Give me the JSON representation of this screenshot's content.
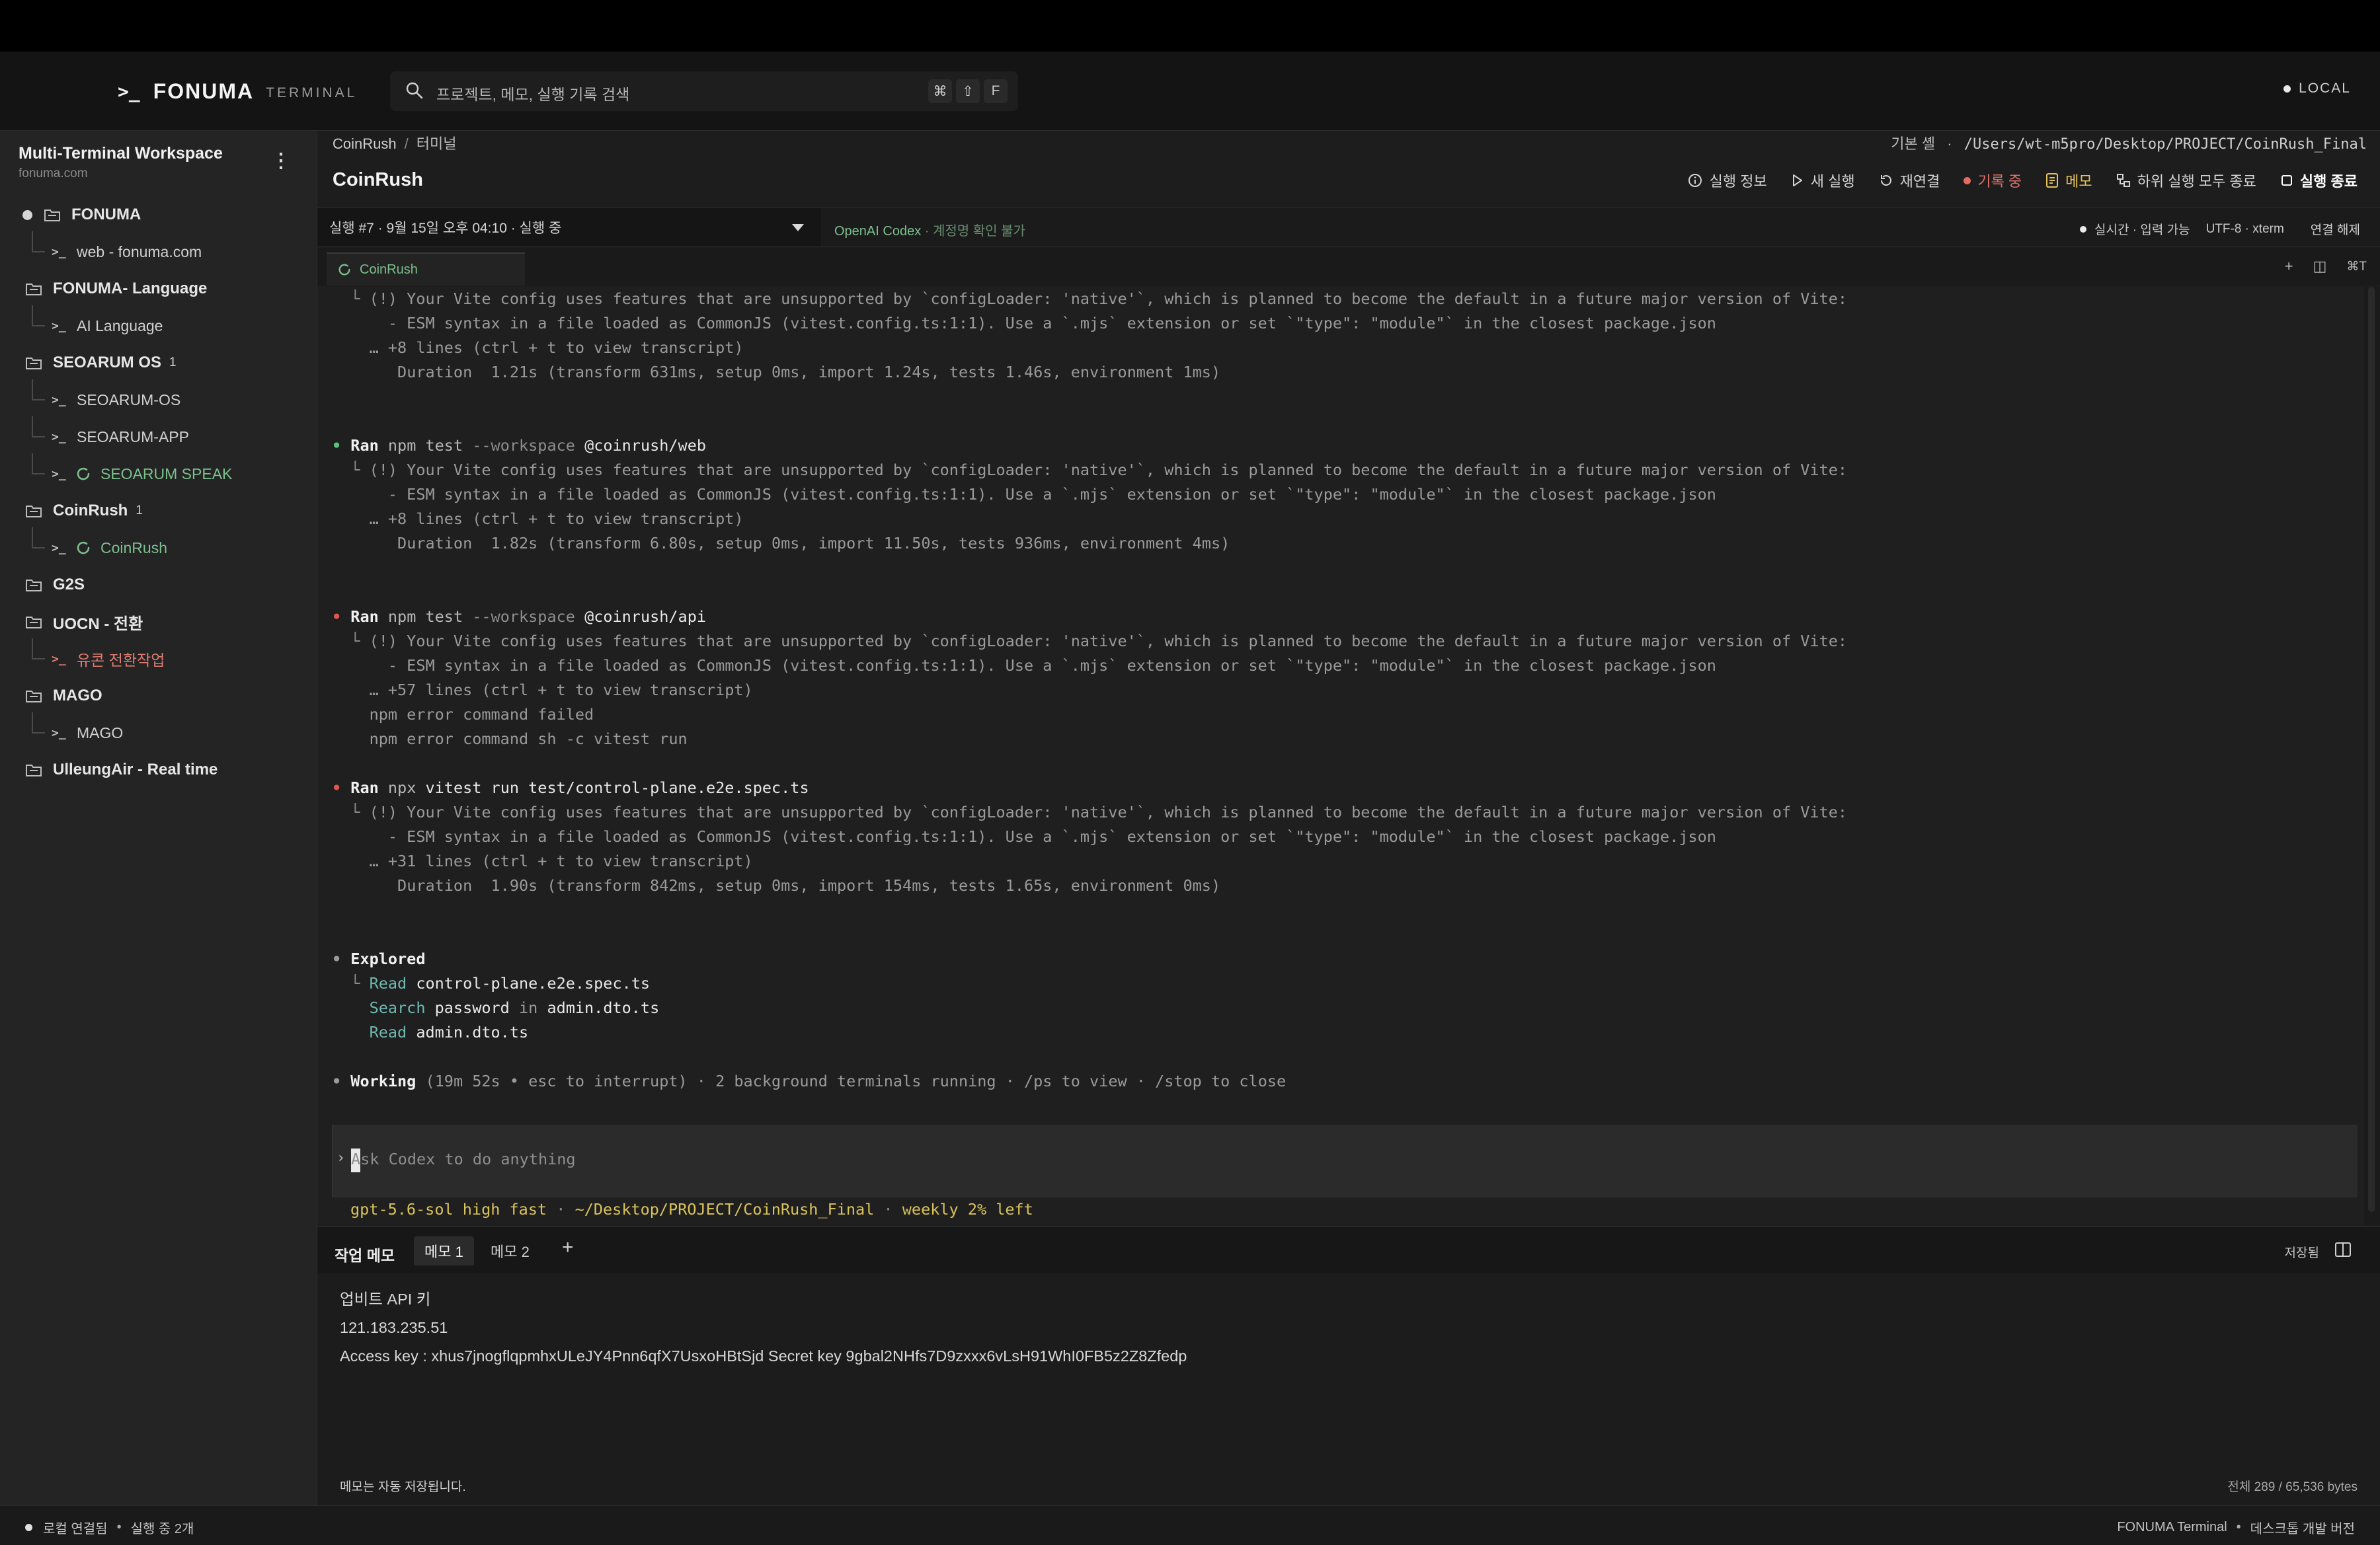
{
  "header": {
    "prompt_glyph": ">_",
    "brand": "FONUMA",
    "brand_sub": "TERMINAL",
    "search_placeholder": "프로젝트, 메모, 실행 기록 검색",
    "shortcut_keys": [
      "⌘",
      "⇧",
      "F"
    ],
    "mode": "LOCAL"
  },
  "sidebar": {
    "workspace_title": "Multi-Terminal Workspace",
    "workspace_sub": "fonuma.com",
    "more": "⋮",
    "groups": [
      {
        "label": "FONUMA",
        "badge": "",
        "active_dot": true,
        "children": [
          {
            "label": "web - fonuma.com",
            "state": "idle"
          }
        ]
      },
      {
        "label": "FONUMA- Language",
        "badge": "",
        "children": [
          {
            "label": "AI Language",
            "state": "idle"
          }
        ]
      },
      {
        "label": "SEOARUM OS",
        "badge": "1",
        "children": [
          {
            "label": "SEOARUM-OS",
            "state": "idle"
          },
          {
            "label": "SEOARUM-APP",
            "state": "idle"
          },
          {
            "label": "SEOARUM SPEAK",
            "state": "running"
          }
        ]
      },
      {
        "label": "CoinRush",
        "badge": "1",
        "children": [
          {
            "label": "CoinRush",
            "state": "running"
          }
        ]
      },
      {
        "label": "G2S",
        "badge": "",
        "children": []
      },
      {
        "label": "UOCN - 전환",
        "badge": "",
        "children": [
          {
            "label": "유콘 전환작업",
            "state": "error"
          }
        ]
      },
      {
        "label": "MAGO",
        "badge": "",
        "children": [
          {
            "label": "MAGO",
            "state": "idle"
          }
        ]
      },
      {
        "label": "UlleungAir - Real time",
        "badge": "",
        "children": []
      }
    ]
  },
  "main": {
    "breadcrumb": {
      "project": "CoinRush",
      "sep": "/",
      "leaf": "터미널"
    },
    "shell": {
      "label": "기본 셸",
      "sep": "·",
      "path": "/Users/wt-m5pro/Desktop/PROJECT/CoinRush_Final"
    },
    "title": "CoinRush",
    "actions": {
      "info": "실행 정보",
      "new_run": "새 실행",
      "reconnect": "재연결",
      "recording": "기록 중",
      "memo": "메모",
      "kill_children": "하위 실행 모두 종료",
      "end_run": "실행 종료"
    },
    "run_select": "실행 #7 · 9월 15일 오후 04:10 · 실행 중",
    "agent": {
      "name": "OpenAI Codex",
      "note": "· 계정명 확인 불가"
    },
    "conn": {
      "status": "실시간 · 입력 가능",
      "encoding": "UTF-8 · xterm",
      "disconnect": "연결 해제"
    },
    "tab": {
      "label": "CoinRush"
    },
    "tab_tools": {
      "add": "+",
      "split": "◫",
      "shortcut": "⌘T"
    }
  },
  "terminal": {
    "vite_warning": "(!) Your Vite config uses features that are unsupported by `configLoader: 'native'`, which is planned to become the default in a future major version of Vite:",
    "esm_line": "- ESM syntax in a file loaded as CommonJS (vitest.config.ts:1:1). Use a `.mjs` extension or set `\"type\": \"module\"` in the closest package.json",
    "block0": {
      "more": "… +8 lines (ctrl + t to view transcript)",
      "duration": "Duration  1.21s (transform 631ms, setup 0ms, import 1.24s, tests 1.46s, environment 1ms)"
    },
    "block1": {
      "ran": "Ran",
      "cmd": "npm",
      "sub": "test",
      "flag": "--workspace",
      "arg": "@coinrush/web",
      "more": "… +8 lines (ctrl + t to view transcript)",
      "duration": "Duration  1.82s (transform 6.80s, setup 0ms, import 11.50s, tests 936ms, environment 4ms)"
    },
    "block2": {
      "ran": "Ran",
      "cmd": "npm",
      "sub": "test",
      "flag": "--workspace",
      "arg": "@coinrush/api",
      "more": "… +57 lines (ctrl + t to view transcript)",
      "err1": "npm error command failed",
      "err2": "npm error command sh -c vitest run"
    },
    "block3": {
      "ran": "Ran",
      "cmd": "npx",
      "sub": "vitest run",
      "arg": "test/control-plane.e2e.spec.ts",
      "more": "… +31 lines (ctrl + t to view transcript)",
      "duration": "Duration  1.90s (transform 842ms, setup 0ms, import 154ms, tests 1.65s, environment 0ms)"
    },
    "explored": {
      "title": "Explored",
      "read1_k": "Read",
      "read1_v": "control-plane.e2e.spec.ts",
      "search_k": "Search",
      "search_v": "password",
      "search_in": "in",
      "search_file": "admin.dto.ts",
      "read2_k": "Read",
      "read2_v": "admin.dto.ts"
    },
    "working": {
      "title": "Working",
      "detail": "(19m 52s • esc to interrupt) · 2 background terminals running · /ps to view · /stop to close"
    },
    "prompt_chev": "›",
    "prompt_placeholder": "Ask Codex to do anything",
    "model_line": "gpt-5.6-sol high fast",
    "model_path": "~/Desktop/PROJECT/CoinRush_Final",
    "model_quota": "weekly 2% left",
    "colors": {
      "success": "#5fbf7a",
      "error": "#e0564a",
      "accent_yellow": "#d9c35a"
    }
  },
  "memo": {
    "title": "작업 메모",
    "tabs": [
      "메모 1",
      "메모 2"
    ],
    "add": "+",
    "saved": "저장됨",
    "lines": [
      "업비트 API 키",
      "121.183.235.51",
      "Access key :  xhus7jnogflqpmhxULeJY4Pnn6qfX7UsxoHBtSjd  Secret key 9gbal2NHfs7D9zxxx6vLsH91WhI0FB5z2Z8Zfedp"
    ],
    "footer_left": "메모는 자동 저장됩니다.",
    "footer_right": "전체 289 / 65,536 bytes"
  },
  "status_bar": {
    "left1": "로컬 연결됨",
    "sep": "•",
    "left2": "실행 중 2개",
    "right1": "FONUMA Terminal",
    "right2": "데스크톱 개발 버전"
  }
}
